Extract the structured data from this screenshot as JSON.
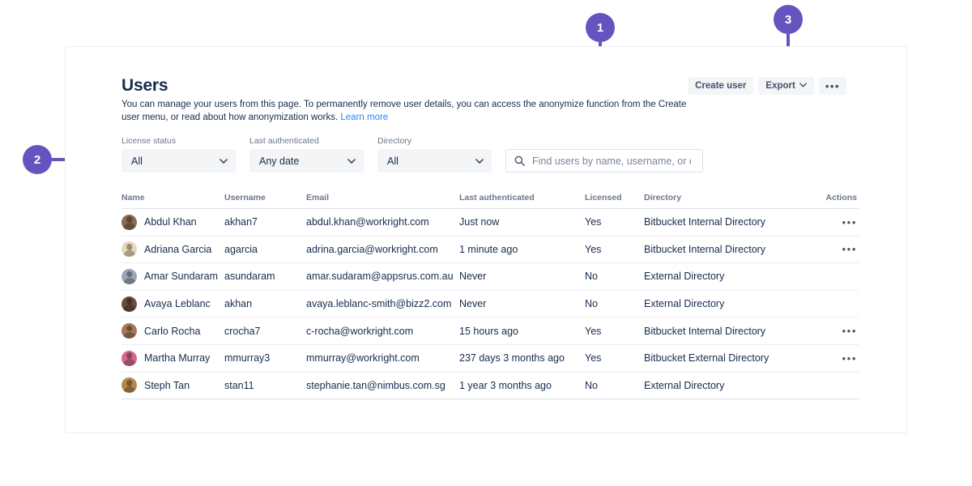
{
  "page": {
    "title": "Users",
    "description_part1": "You can manage your users from this page. To permanently remove user details, you can access the anonymize function from the Create user menu, or read about how anonymization works. ",
    "learn_more": "Learn more"
  },
  "toolbar": {
    "create_user": "Create user",
    "export": "Export",
    "export_caret": "⌄",
    "more": "•••"
  },
  "filters": [
    {
      "label": "License status",
      "value": "All",
      "name": "license-status"
    },
    {
      "label": "Last authenticated",
      "value": "Any date",
      "name": "last-authenticated"
    },
    {
      "label": "Directory",
      "value": "All",
      "name": "directory"
    }
  ],
  "search": {
    "placeholder": "Find users by name, username, or email",
    "value": ""
  },
  "table": {
    "columns": [
      "Name",
      "Username",
      "Email",
      "Last authenticated",
      "Licensed",
      "Directory",
      "Actions"
    ],
    "rows": [
      {
        "name": "Abdul Khan",
        "username": "akhan7",
        "email": "abdul.khan@workright.com",
        "last_authenticated": "Just now",
        "licensed": "Yes",
        "directory": "Bitbucket Internal Directory",
        "actions": "•••",
        "avatar_color": "#8C6B4F"
      },
      {
        "name": "Adriana Garcia",
        "username": "agarcia",
        "email": "adrina.garcia@workright.com",
        "last_authenticated": "1 minute ago",
        "licensed": "Yes",
        "directory": "Bitbucket Internal Directory",
        "actions": "•••",
        "avatar_color": "#E8D7B8"
      },
      {
        "name": "Amar Sundaram",
        "username": "asundaram",
        "email": "amar.sudaram@appsrus.com.au",
        "last_authenticated": "Never",
        "licensed": "No",
        "directory": "External Directory",
        "actions": "",
        "avatar_color": "#9AA7B8"
      },
      {
        "name": "Avaya Leblanc",
        "username": "akhan",
        "email": "avaya.leblanc-smith@bizz2.com",
        "last_authenticated": "Never",
        "licensed": "No",
        "directory": "External Directory",
        "actions": "",
        "avatar_color": "#6E4B3A"
      },
      {
        "name": "Carlo Rocha",
        "username": "crocha7",
        "email": "c-rocha@workright.com",
        "last_authenticated": "15 hours ago",
        "licensed": "Yes",
        "directory": "Bitbucket Internal Directory",
        "actions": "•••",
        "avatar_color": "#A5765A"
      },
      {
        "name": "Martha Murray",
        "username": "mmurray3",
        "email": "mmurray@workright.com",
        "last_authenticated": "237 days 3 months ago",
        "licensed": "Yes",
        "directory": "Bitbucket External Directory",
        "actions": "•••",
        "avatar_color": "#D46A8C"
      },
      {
        "name": "Steph Tan",
        "username": "stan11",
        "email": "stephanie.tan@nimbus.com.sg",
        "last_authenticated": "1 year 3 months ago",
        "licensed": "No",
        "directory": "External Directory",
        "actions": "",
        "avatar_color": "#B5894E"
      }
    ]
  },
  "callouts": [
    {
      "number": "1",
      "target": "licensed-column-header"
    },
    {
      "number": "2",
      "target": "license-status-filter"
    },
    {
      "number": "3",
      "target": "export-button"
    }
  ],
  "colors": {
    "accent_purple": "#6554C0",
    "link_blue": "#2684FF",
    "text_primary": "#172B4D",
    "text_subtle": "#6B778C"
  }
}
